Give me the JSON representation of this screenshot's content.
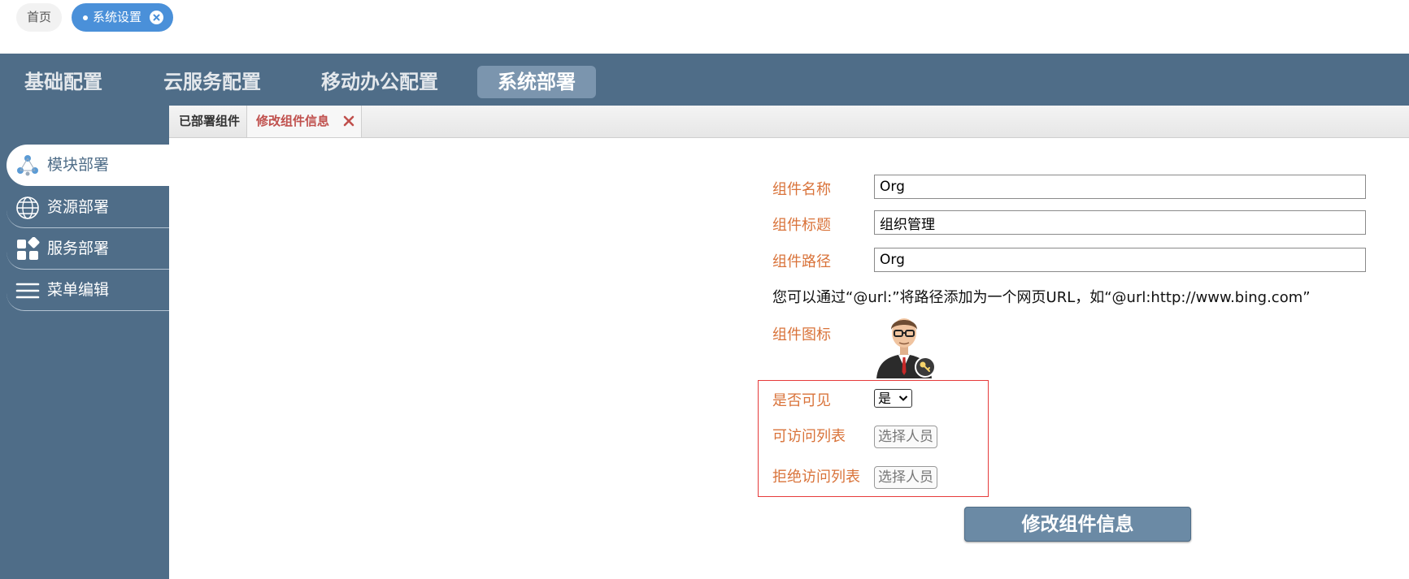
{
  "tags": {
    "home_label": "首页",
    "active_label": "系统设置"
  },
  "topnav": [
    {
      "label": "基础配置"
    },
    {
      "label": "云服务配置"
    },
    {
      "label": "移动办公配置"
    },
    {
      "label": "系统部署",
      "active": true
    }
  ],
  "sidebar": {
    "items": [
      {
        "label": "模块部署",
        "icon": "network-nodes-icon",
        "active": true
      },
      {
        "label": "资源部署",
        "icon": "globe-icon"
      },
      {
        "label": "服务部署",
        "icon": "grid-apps-icon"
      },
      {
        "label": "菜单编辑",
        "icon": "menu-lines-icon"
      }
    ]
  },
  "tabs": [
    {
      "label": "已部署组件"
    },
    {
      "label": "修改组件信息",
      "active": true,
      "closable": true
    }
  ],
  "form": {
    "name_label": "组件名称",
    "name_value": "Org",
    "title_label": "组件标题",
    "title_value": "组织管理",
    "path_label": "组件路径",
    "path_value": "Org",
    "hint": "您可以通过“@url:”将路径添加为一个网页URL，如“@url:http://www.bing.com”",
    "icon_label": "组件图标",
    "icon": "businessman-avatar-icon",
    "visible_label": "是否可见",
    "visible_value": "是",
    "allow_label": "可访问列表",
    "allow_button": "选择人员",
    "deny_label": "拒绝访问列表",
    "deny_button": "选择人员",
    "submit_label": "修改组件信息"
  },
  "colors": {
    "header_bg": "#4f6d88",
    "label_orange": "#d9733a",
    "active_tag_blue": "#4a90d9",
    "highlight_red": "#e63b3b"
  }
}
